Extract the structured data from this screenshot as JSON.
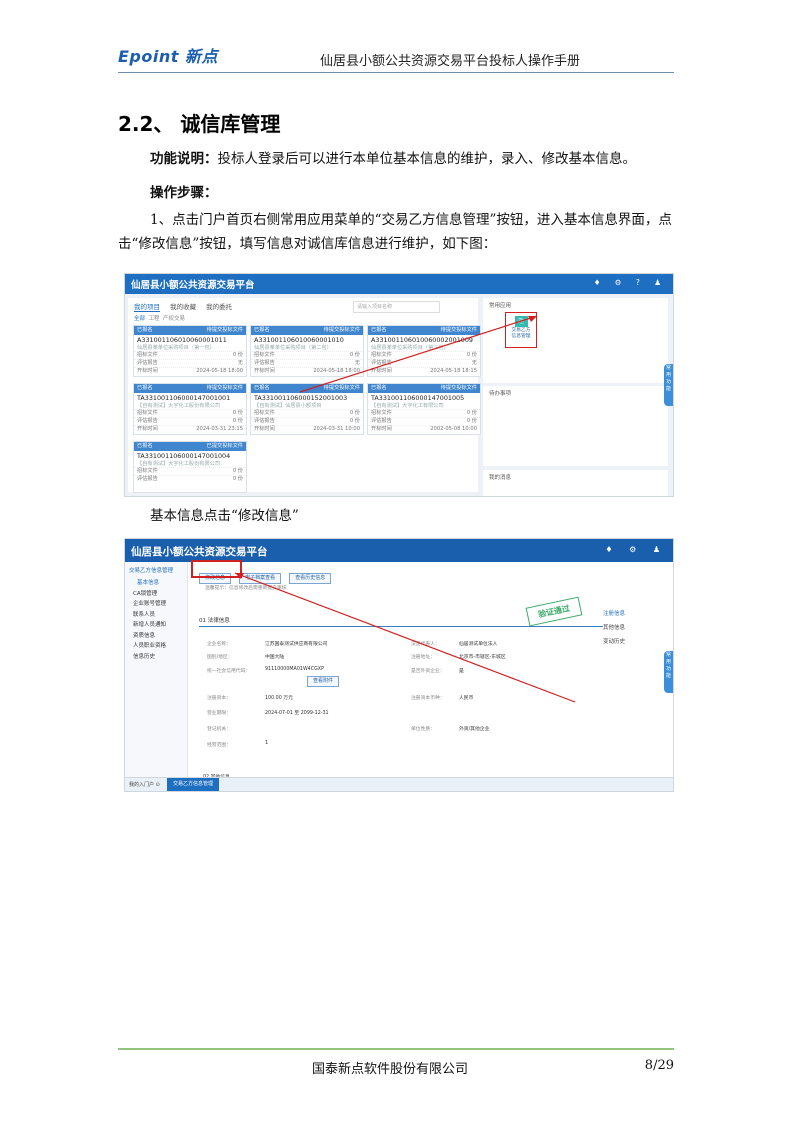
{
  "header": {
    "logo": "Epoint 新点",
    "title": "仙居县小额公共资源交易平台投标人操作手册"
  },
  "section": {
    "heading": "2.2、 诚信库管理"
  },
  "function_desc": {
    "label": "功能说明：",
    "text": "投标人登录后可以进行本单位基本信息的维护，录入、修改基本信息。"
  },
  "steps_label": "操作步骤：",
  "step1": "1、点击门户首页右侧常用应用菜单的“交易乙方信息管理”按钮，进入基本信息界面，点击“修改信息”按钮，填写信息对诚信库信息进行维护，如下图：",
  "caption2": "基本信息点击“修改信息”",
  "screenshot1": {
    "app_title": "仙居县小额公共资源交易平台",
    "home_icon": "home-icon",
    "top_icons": "♦ ⚙ ? ♟",
    "tabs": [
      "我的项目",
      "我的收藏",
      "我的委托"
    ],
    "search_placeholder": "请输入项目名称",
    "filters": [
      "全部",
      "工程",
      "产权交易"
    ],
    "cards": [
      {
        "status": "已报名",
        "stage": "待提交投标文件",
        "code": "A331001106010060001011",
        "sub": "仙居县某单位采购项目（第一包）",
        "rows": [
          [
            "招标文件",
            "0 份"
          ],
          [
            "评估报告",
            "无"
          ],
          [
            "开标时间",
            "2024-05-18 18:00"
          ]
        ]
      },
      {
        "status": "已报名",
        "stage": "待提交投标文件",
        "code": "A331001106010060001010",
        "sub": "仙居县某单位采购项目（第二包）",
        "rows": [
          [
            "招标文件",
            "0 份"
          ],
          [
            "评估报告",
            "无"
          ],
          [
            "开标时间",
            "2024-05-18 18:00"
          ]
        ]
      },
      {
        "status": "已报名",
        "stage": "待提交投标文件",
        "code": "A331001106010060002001009",
        "sub": "仙居县某单位采购项目（第三包）",
        "rows": [
          [
            "招标文件",
            "0 份"
          ],
          [
            "评估报告",
            "无"
          ],
          [
            "开标时间",
            "2024-05-18 18:15"
          ]
        ]
      },
      {
        "status": "已报名",
        "stage": "待提交投标文件",
        "code": "TA331001106000147001001",
        "sub": "【自有测试】大宇化工股份有限公司",
        "rows": [
          [
            "招标文件",
            "0 份"
          ],
          [
            "评估报告",
            "0 份"
          ],
          [
            "开标时间",
            "2024-03-31 23:15"
          ]
        ]
      },
      {
        "status": "已报名",
        "stage": "待提交投标文件",
        "code": "TA331001106000152001003",
        "sub": "【自有测试】仙居县小额项目",
        "rows": [
          [
            "招标文件",
            "0 份"
          ],
          [
            "评估报告",
            "0 份"
          ],
          [
            "开标时间",
            "2024-03-31 10:00"
          ]
        ]
      },
      {
        "status": "已报名",
        "stage": "待提交投标文件",
        "code": "TA331001106000147001005",
        "sub": "【自有测试】大宇化工有限公司",
        "rows": [
          [
            "招标文件",
            "0 份"
          ],
          [
            "评估报告",
            "0 份"
          ],
          [
            "开标时间",
            "2002-05-08 10:00"
          ]
        ]
      },
      {
        "status": "已报名",
        "stage": "已提交投标文件",
        "code": "TA331001106000147001004",
        "sub": "【自有测试】大宇化工股份有限公司",
        "rows": [
          [
            "招标文件",
            "0 份"
          ],
          [
            "评估报告",
            "0 份"
          ]
        ]
      }
    ],
    "right_panels": [
      "常用应用",
      "待办事项",
      "我的消息"
    ],
    "app_button": {
      "icon": "⎘",
      "label_line1": "交易乙方",
      "label_line2": "信息管理"
    },
    "side_tab": "常用功能"
  },
  "screenshot2": {
    "app_title": "仙居县小额公共资源交易平台",
    "top_icons": "♦ ⚙ ♟",
    "menu_top": "交易乙方信息管理",
    "menu": [
      "基本信息",
      "CA锁管理",
      "企业账号管理",
      "联系人员",
      "新增人员通知",
      "资质信息",
      "人员职业资格",
      "信息历史"
    ],
    "buttons": [
      "修改信息",
      "电子档案查看",
      "查看历史信息"
    ],
    "hint": "温馨提示：信息修改后需重新提交审核",
    "section1": "01 法律信息",
    "stamp": "验证通过",
    "fields": [
      [
        "企业名称：",
        "江苏国泰测试供应商有限公司",
        "法定代表人：",
        "仙居测试单位法人"
      ],
      [
        "国别/地区：",
        "中国大陆",
        "注册地址：",
        "北京市-市辖区-东城区"
      ],
      [
        "统一社会信用代码：",
        "91110000MA01W4CGXP",
        "是否外资企业：",
        "是"
      ],
      [
        "注册资本：",
        "100.00 万元",
        "注册资本币种：",
        "人民币"
      ],
      [
        "营业期限：",
        "2024-07-01 至 2099-12-31",
        "",
        ""
      ],
      [
        "登记机关：",
        "",
        "单位性质：",
        "外资/其他企业"
      ],
      [
        "经营范围：",
        "1",
        "",
        ""
      ]
    ],
    "view_button": "查看附件",
    "toc": [
      "注册信息",
      "其他信息",
      "变动历史"
    ],
    "section2": "02 其他信息",
    "footer_left": "我的入门户 ⊙",
    "footer_tab": "交易乙方信息管理",
    "side_tab": "常用功能"
  },
  "footer": {
    "company": "国泰新点软件股份有限公司",
    "page": "8/29"
  },
  "colors": {
    "brand_blue": "#1e6fc2",
    "highlight_red": "#d21f1f",
    "footer_green": "#93c47d"
  }
}
